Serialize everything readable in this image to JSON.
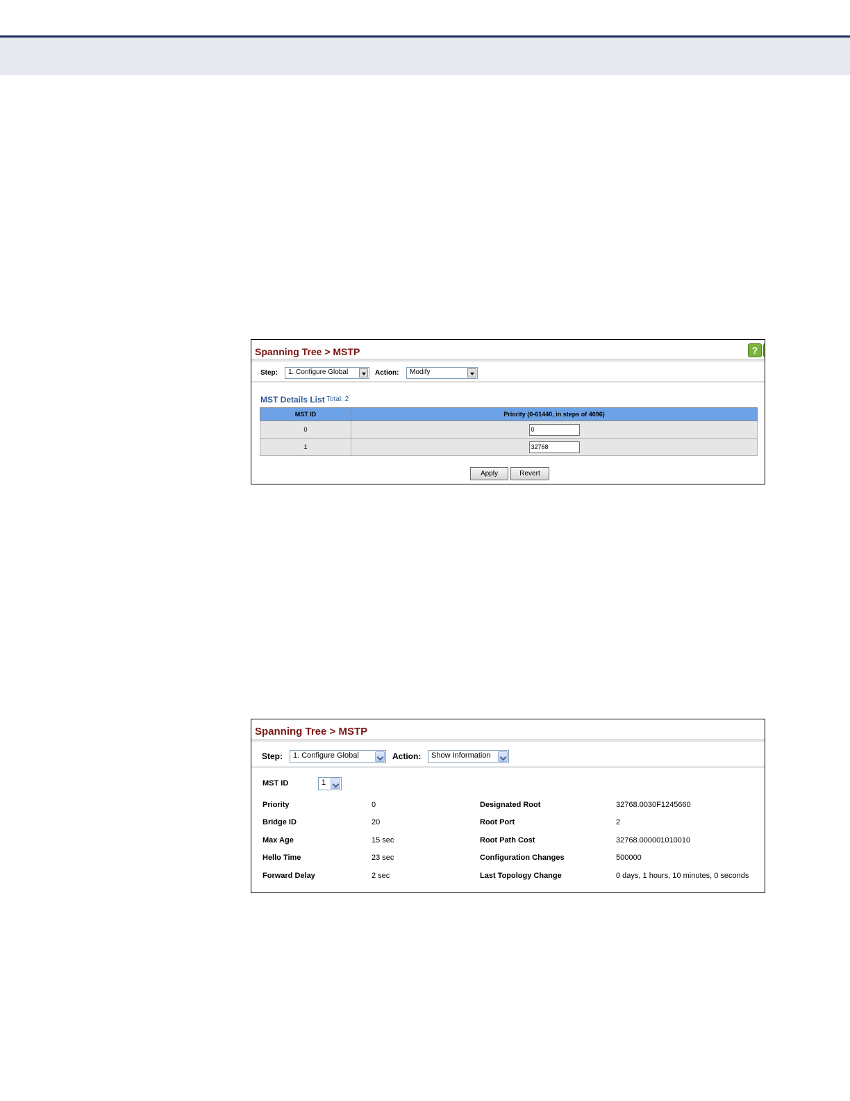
{
  "panel1": {
    "title": "Spanning Tree > MSTP",
    "step_label": "Step:",
    "step_value": "1. Configure Global",
    "action_label": "Action:",
    "action_value": "Modify",
    "list_title": "MST Details List",
    "list_total": "Total: 2",
    "columns": [
      "MST ID",
      "Priority (0-61440, in steps of 4096)"
    ],
    "rows": [
      {
        "id": "0",
        "priority": "0"
      },
      {
        "id": "1",
        "priority": "32768"
      }
    ],
    "apply_label": "Apply",
    "revert_label": "Revert",
    "help_glyph": "?"
  },
  "panel2": {
    "title": "Spanning Tree > MSTP",
    "step_label": "Step:",
    "step_value": "1. Configure Global",
    "action_label": "Action:",
    "action_value": "Show Information",
    "mst_id_label": "MST ID",
    "mst_id_value": "1",
    "left_fields": [
      {
        "label": "Priority",
        "value": "0"
      },
      {
        "label": "Bridge ID",
        "value": "20"
      },
      {
        "label": "Max Age",
        "value": "15 sec"
      },
      {
        "label": "Hello Time",
        "value": "23 sec"
      },
      {
        "label": "Forward Delay",
        "value": "2 sec"
      }
    ],
    "right_fields": [
      {
        "label": "Designated Root",
        "value": "32768.0030F1245660"
      },
      {
        "label": "Root Port",
        "value": "2"
      },
      {
        "label": "Root Path Cost",
        "value": "32768.000001010010"
      },
      {
        "label": "Configuration Changes",
        "value": "500000"
      },
      {
        "label": "Last Topology Change",
        "value": "0 days, 1 hours, 10 minutes, 0 seconds"
      }
    ]
  },
  "colors": {
    "title": "#7a1515",
    "table_header": "#6ea2e6",
    "list_title": "#2d5a96",
    "top_rule": "#1c2c5c",
    "help_icon": "#7bb43a"
  }
}
